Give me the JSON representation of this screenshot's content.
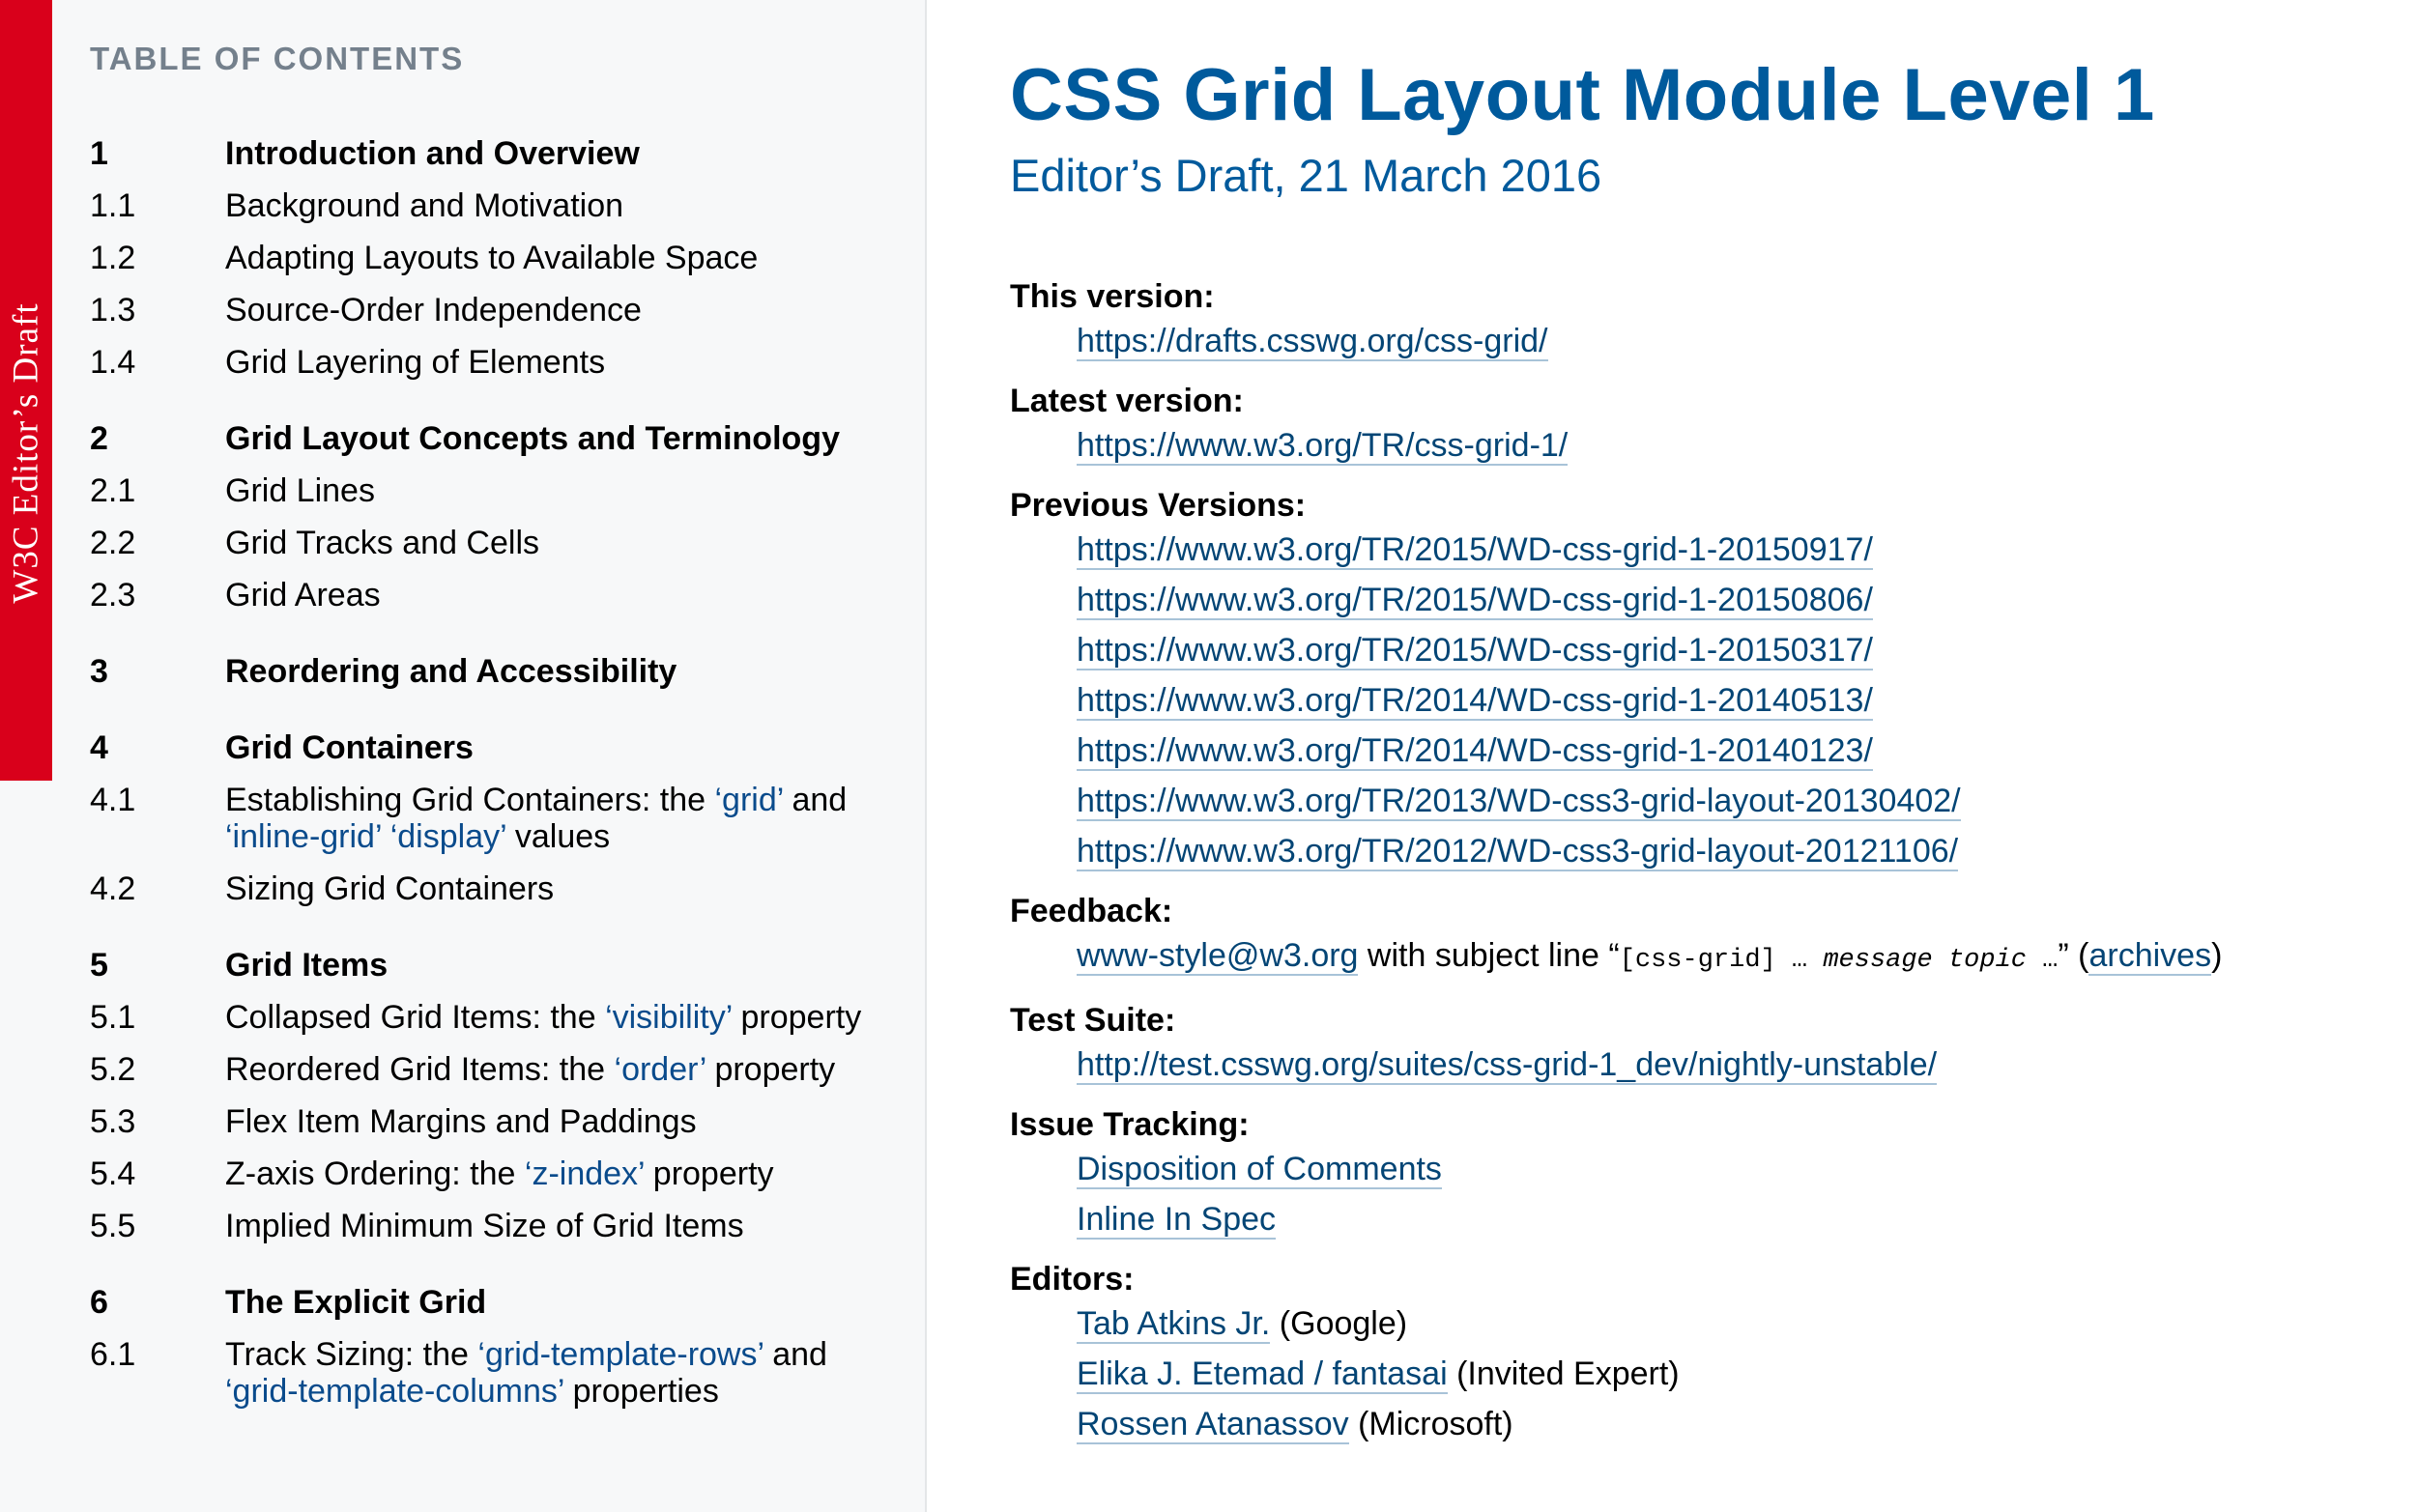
{
  "sidebar": {
    "status_tab": "W3C Editor’s Draft",
    "toc_heading": "TABLE OF CONTENTS",
    "sections": [
      {
        "num": "1",
        "title": "Introduction and Overview",
        "items": [
          {
            "num": "1.1",
            "title": "Background and Motivation"
          },
          {
            "num": "1.2",
            "title": "Adapting Layouts to Available Space"
          },
          {
            "num": "1.3",
            "title": "Source-Order Independence"
          },
          {
            "num": "1.4",
            "title": "Grid Layering of Elements"
          }
        ]
      },
      {
        "num": "2",
        "title": "Grid Layout Concepts and Terminology",
        "items": [
          {
            "num": "2.1",
            "title": "Grid Lines"
          },
          {
            "num": "2.2",
            "title": "Grid Tracks and Cells"
          },
          {
            "num": "2.3",
            "title": "Grid Areas"
          }
        ]
      },
      {
        "num": "3",
        "title": "Reordering and Accessibility",
        "items": []
      },
      {
        "num": "4",
        "title": "Grid Containers",
        "items": [
          {
            "num": "4.1",
            "parts": [
              {
                "t": "Establishing Grid Containers: the "
              },
              {
                "t": "‘grid’",
                "term": true
              },
              {
                "t": " and "
              },
              {
                "t": "‘inline-grid’",
                "term": true
              },
              {
                "t": " "
              },
              {
                "t": "‘display’",
                "term": true
              },
              {
                "t": " values"
              }
            ]
          },
          {
            "num": "4.2",
            "title": "Sizing Grid Containers"
          }
        ]
      },
      {
        "num": "5",
        "title": "Grid Items",
        "items": [
          {
            "num": "5.1",
            "parts": [
              {
                "t": "Collapsed Grid Items: the "
              },
              {
                "t": "‘visibility’",
                "term": true
              },
              {
                "t": " property"
              }
            ]
          },
          {
            "num": "5.2",
            "parts": [
              {
                "t": "Reordered Grid Items: the "
              },
              {
                "t": "‘order’",
                "term": true
              },
              {
                "t": " property"
              }
            ]
          },
          {
            "num": "5.3",
            "title": "Flex Item Margins and Paddings"
          },
          {
            "num": "5.4",
            "parts": [
              {
                "t": "Z-axis Ordering: the "
              },
              {
                "t": "‘z-index’",
                "term": true
              },
              {
                "t": " property"
              }
            ]
          },
          {
            "num": "5.5",
            "title": "Implied Minimum Size of Grid Items"
          }
        ]
      },
      {
        "num": "6",
        "title": "The Explicit Grid",
        "items": [
          {
            "num": "6.1",
            "parts": [
              {
                "t": "Track Sizing: the "
              },
              {
                "t": "‘grid-template-rows’",
                "term": true
              },
              {
                "t": " and "
              },
              {
                "t": "‘grid-template-columns’",
                "term": true
              },
              {
                "t": " properties"
              }
            ]
          }
        ]
      }
    ]
  },
  "main": {
    "title": "CSS Grid Layout Module Level 1",
    "subtitle": "Editor’s Draft, 21 March 2016",
    "this_version": {
      "label": "This version:",
      "url": "https://drafts.csswg.org/css-grid/"
    },
    "latest_version": {
      "label": "Latest version:",
      "url": "https://www.w3.org/TR/css-grid-1/"
    },
    "previous_versions": {
      "label": "Previous Versions:",
      "urls": [
        "https://www.w3.org/TR/2015/WD-css-grid-1-20150917/",
        "https://www.w3.org/TR/2015/WD-css-grid-1-20150806/",
        "https://www.w3.org/TR/2015/WD-css-grid-1-20150317/",
        "https://www.w3.org/TR/2014/WD-css-grid-1-20140513/",
        "https://www.w3.org/TR/2014/WD-css-grid-1-20140123/",
        "https://www.w3.org/TR/2013/WD-css3-grid-layout-20130402/",
        "https://www.w3.org/TR/2012/WD-css3-grid-layout-20121106/"
      ]
    },
    "feedback": {
      "label": "Feedback:",
      "email": "www-style@w3.org",
      "text_before": " with subject line “",
      "code_prefix": "[css-grid]",
      "code_ellipsis1": " … ",
      "code_var": "message topic",
      "code_ellipsis2": " …",
      "text_after": "” (",
      "archives": "archives",
      "close": ")"
    },
    "test_suite": {
      "label": "Test Suite:",
      "url": "http://test.csswg.org/suites/css-grid-1_dev/nightly-unstable/"
    },
    "issue_tracking": {
      "label": "Issue Tracking:",
      "links": [
        "Disposition of Comments",
        "Inline In Spec"
      ]
    },
    "editors": {
      "label": "Editors:",
      "list": [
        {
          "name": "Tab Atkins Jr.",
          "affiliation": " (Google)"
        },
        {
          "name": "Elika J. Etemad / fantasai",
          "affiliation": " (Invited Expert)"
        },
        {
          "name": "Rossen Atanassov",
          "affiliation": " (Microsoft)"
        }
      ]
    }
  },
  "colors": {
    "status_red": "#d9001b",
    "title_blue": "#005a9c",
    "link_blue": "#034575",
    "toc_heading_gray": "#74808c",
    "sidebar_bg": "#f7f8f9"
  }
}
